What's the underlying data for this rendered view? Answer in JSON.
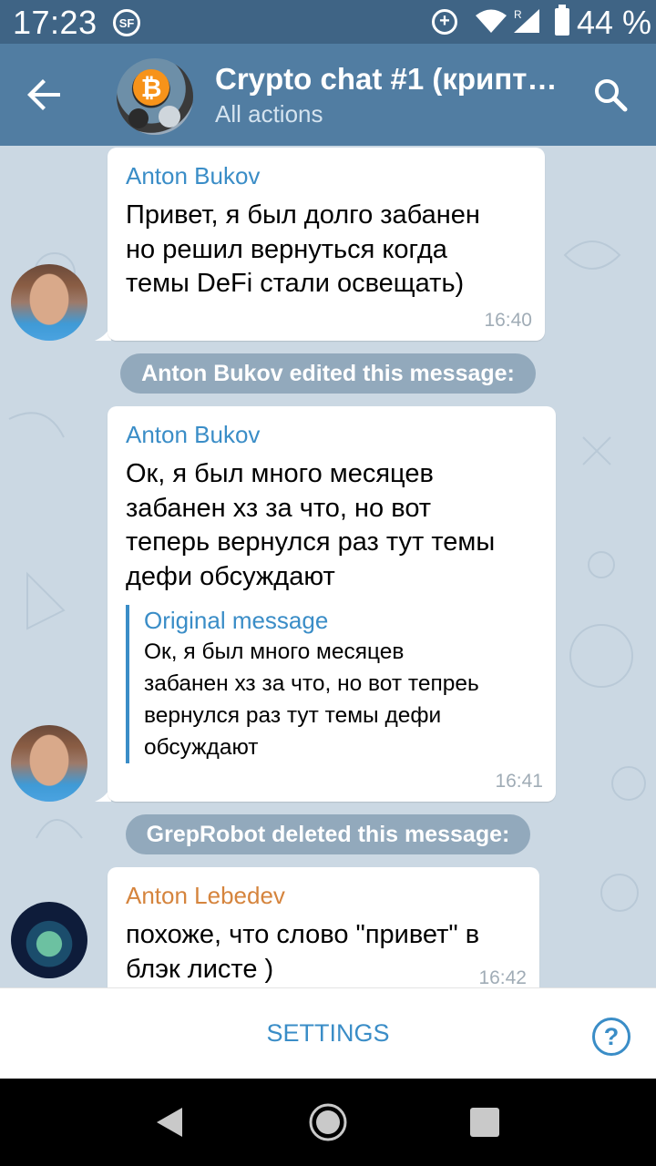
{
  "status_bar": {
    "time": "17:23",
    "carrier_icon": "SF",
    "data_saver_icon": "+",
    "roaming_indicator": "R",
    "battery": "44 %"
  },
  "header": {
    "title": "Crypto chat #1 (крипт…",
    "subtitle": "All actions"
  },
  "messages": [
    {
      "sender": "Anton Bukov",
      "lines": [
        "Привет, я был долго забанен",
        "но решил вернуться когда",
        "темы DeFi стали освещать)"
      ],
      "time": "16:40"
    },
    {
      "service": "Anton Bukov edited this message:"
    },
    {
      "sender": "Anton Bukov",
      "lines": [
        "Ок, я был много месяцев",
        "забанен хз за что, но вот",
        "теперь вернулся раз тут темы",
        "дефи обсуждают"
      ],
      "quote_title": "Original message",
      "quote_lines": [
        "Ок, я был много месяцев",
        "забанен хз за что, но вот тепреь",
        "вернулся раз тут темы дефи",
        "обсуждают"
      ],
      "time": "16:41"
    },
    {
      "service": "GrepRobot deleted this message:"
    },
    {
      "sender": "Anton Lebedev",
      "sender_color": "#d5843d",
      "lines": [
        "похоже, что слово \"привет\" в",
        "блэк листе )"
      ],
      "time": "16:42"
    }
  ],
  "bottom_bar": {
    "settings_label": "SETTINGS",
    "help_label": "?"
  },
  "colors": {
    "header": "#517da2",
    "status_bar": "#3f6485",
    "accent": "#3a8dc7",
    "chat_background": "#cbd8e3"
  }
}
